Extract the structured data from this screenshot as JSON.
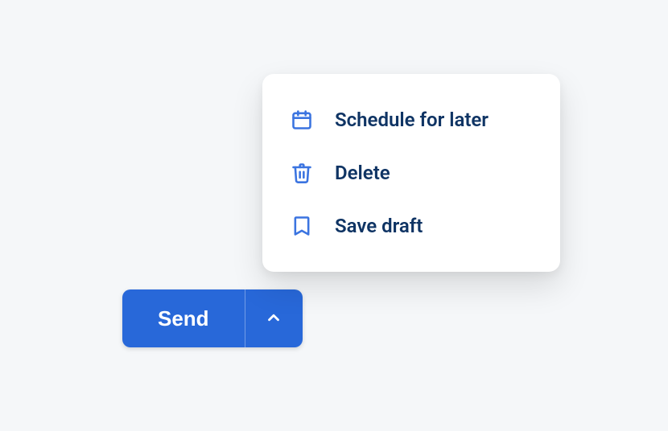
{
  "button": {
    "send_label": "Send"
  },
  "menu": {
    "items": [
      {
        "label": "Schedule for later"
      },
      {
        "label": "Delete"
      },
      {
        "label": "Save draft"
      }
    ]
  }
}
